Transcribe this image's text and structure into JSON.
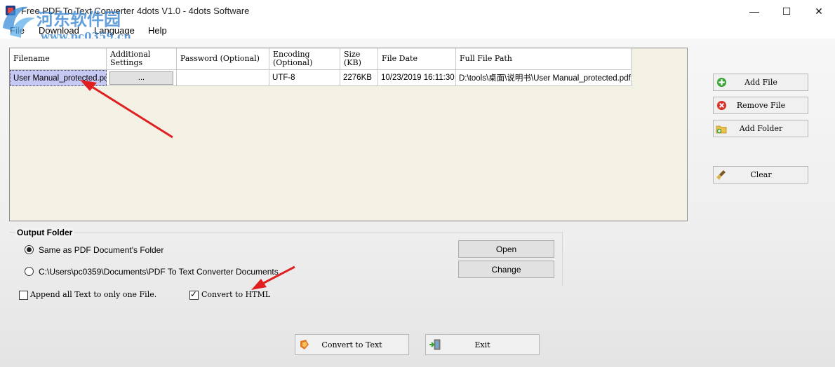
{
  "window": {
    "title": "Free PDF To Text Converter 4dots V1.0 - 4dots Software",
    "watermark": "河东软件园",
    "watermark_url": "www.pc0359.cn"
  },
  "menu": [
    "File",
    "Download",
    "Language",
    "Help"
  ],
  "grid": {
    "columns": [
      "Filename",
      "Additional Settings",
      "Password (Optional)",
      "Encoding (Optional)",
      "Size (KB)",
      "File Date",
      "Full File Path"
    ],
    "rows": [
      {
        "filename": "User Manual_protected.pdf",
        "settings": "...",
        "password": "",
        "encoding": "UTF-8",
        "size": "2276KB",
        "date": "10/23/2019 16:11:30",
        "path": "D:\\tools\\桌面\\说明书\\User Manual_protected.pdf"
      }
    ]
  },
  "side_buttons": {
    "add_file": "Add File",
    "remove_file": "Remove File",
    "add_folder": "Add Folder",
    "clear": "Clear"
  },
  "output_folder": {
    "title": "Output Folder",
    "option_same": "Same as PDF Document's Folder",
    "option_path": "C:\\Users\\pc0359\\Documents\\PDF To Text Converter Documents",
    "selected": "same",
    "open_label": "Open",
    "change_label": "Change"
  },
  "options": {
    "append_label": "Append all Text to only one File.",
    "append_checked": false,
    "html_label": "Convert to HTML",
    "html_checked": true
  },
  "bottom": {
    "convert_label": "Convert to Text",
    "exit_label": "Exit"
  },
  "colors": {
    "grid_background": "#f3f0e4",
    "selected_cell": "#c7c9f5",
    "annotation_arrow": "#e02020"
  }
}
